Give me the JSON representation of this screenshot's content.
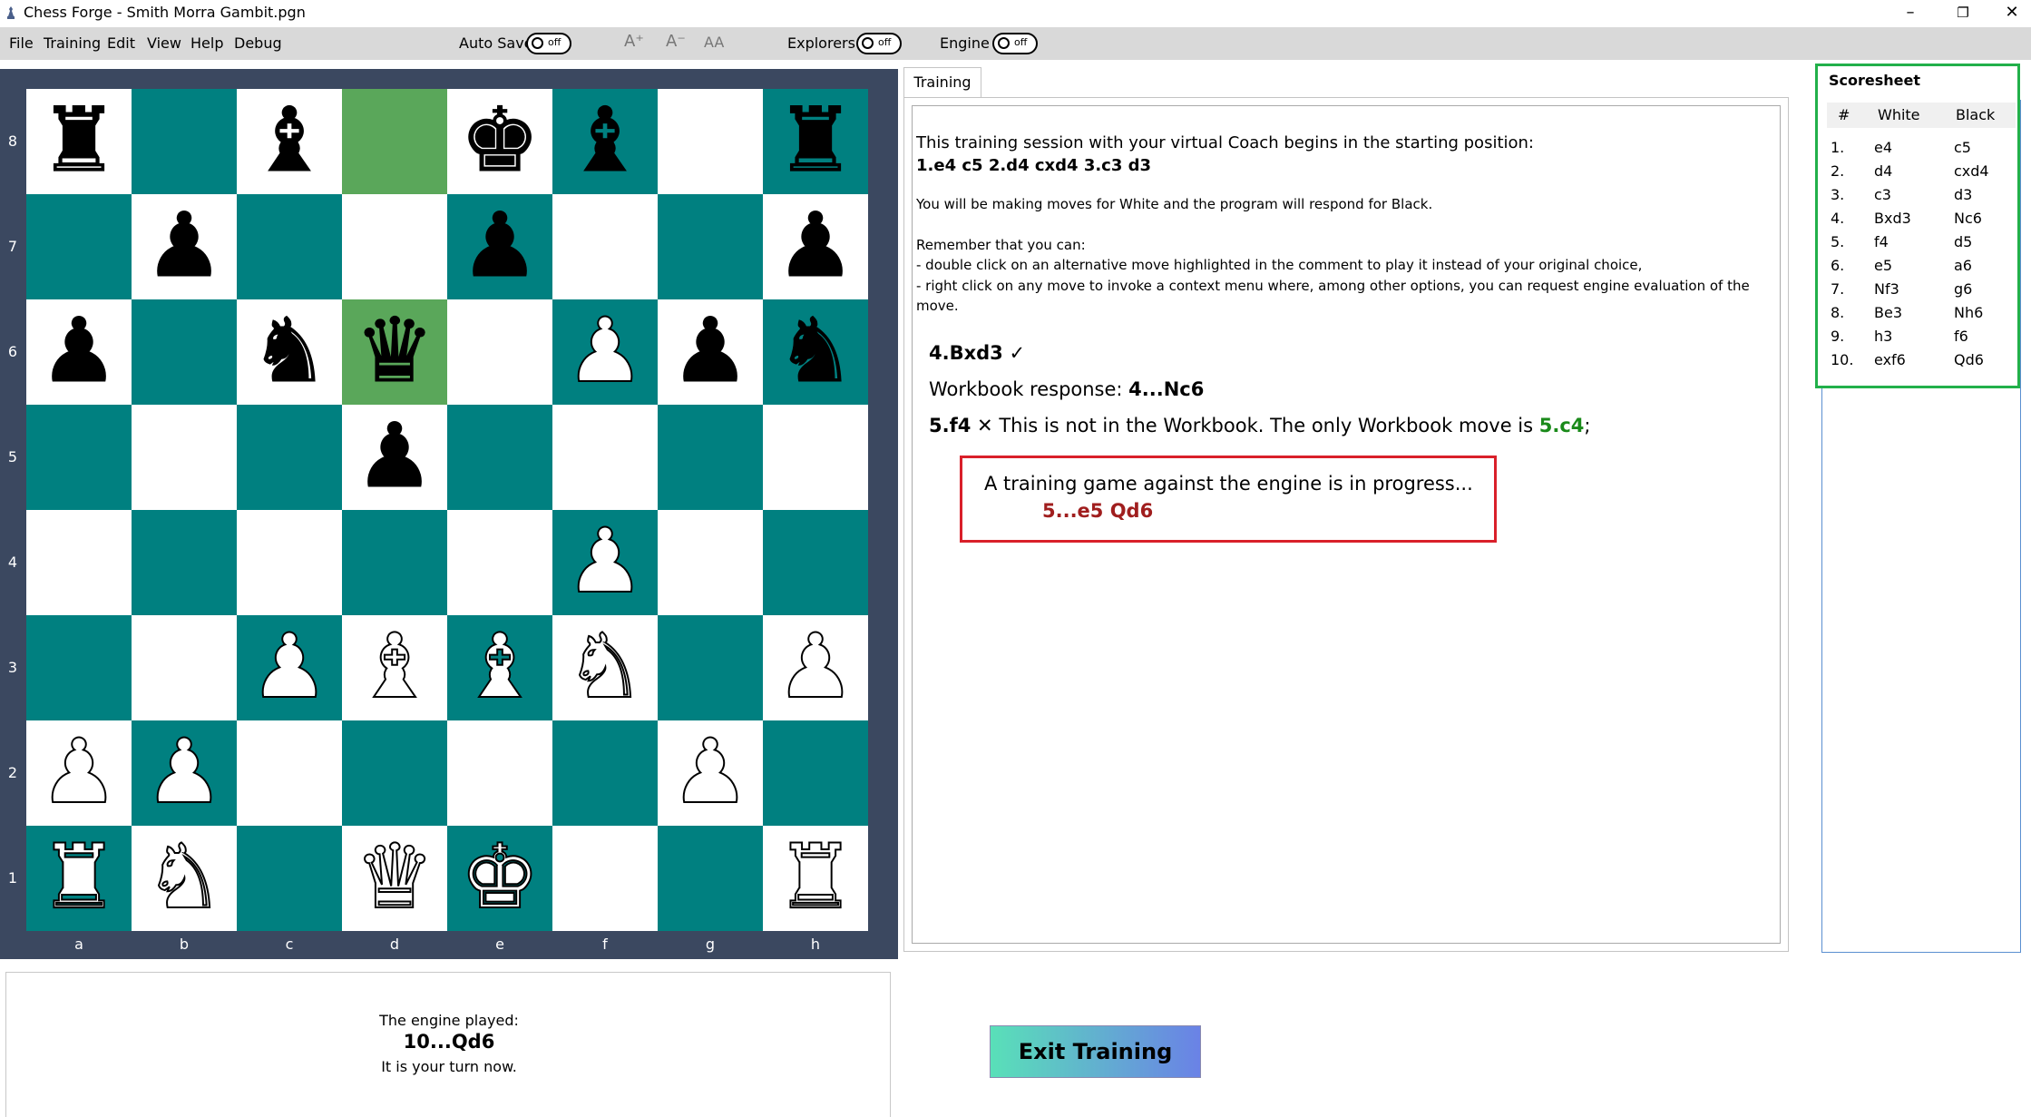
{
  "window": {
    "title": "Chess Forge - Smith Morra Gambit.pgn",
    "controls": {
      "minimize": "–",
      "restore": "❐",
      "close": "✕"
    }
  },
  "menu": {
    "items": [
      "File",
      "Training",
      "Edit",
      "View",
      "Help",
      "Debug"
    ]
  },
  "toolbar": {
    "auto_save_label": "Auto Save",
    "auto_save_state": "off",
    "font_buttons": [
      "A⁺",
      "A⁻",
      "AA"
    ],
    "explorers_label": "Explorers",
    "explorers_state": "off",
    "engine_label": "Engine",
    "engine_state": "off"
  },
  "board": {
    "ranks": [
      "8",
      "7",
      "6",
      "5",
      "4",
      "3",
      "2",
      "1"
    ],
    "files": [
      "a",
      "b",
      "c",
      "d",
      "e",
      "f",
      "g",
      "h"
    ],
    "highlighted_squares": [
      "d8",
      "d6"
    ],
    "pieces": [
      {
        "square": "a8",
        "piece": "rook",
        "color": "black",
        "glyph": "♜"
      },
      {
        "square": "c8",
        "piece": "bishop",
        "color": "black",
        "glyph": "♝"
      },
      {
        "square": "e8",
        "piece": "king",
        "color": "black",
        "glyph": "♚"
      },
      {
        "square": "f8",
        "piece": "bishop",
        "color": "black",
        "glyph": "♝"
      },
      {
        "square": "h8",
        "piece": "rook",
        "color": "black",
        "glyph": "♜"
      },
      {
        "square": "b7",
        "piece": "pawn",
        "color": "black",
        "glyph": "♟"
      },
      {
        "square": "e7",
        "piece": "pawn",
        "color": "black",
        "glyph": "♟"
      },
      {
        "square": "h7",
        "piece": "pawn",
        "color": "black",
        "glyph": "♟"
      },
      {
        "square": "a6",
        "piece": "pawn",
        "color": "black",
        "glyph": "♟"
      },
      {
        "square": "c6",
        "piece": "knight",
        "color": "black",
        "glyph": "♞"
      },
      {
        "square": "d6",
        "piece": "queen",
        "color": "black",
        "glyph": "♛"
      },
      {
        "square": "f6",
        "piece": "pawn",
        "color": "white",
        "glyph": "♟"
      },
      {
        "square": "g6",
        "piece": "pawn",
        "color": "black",
        "glyph": "♟"
      },
      {
        "square": "h6",
        "piece": "knight",
        "color": "black",
        "glyph": "♞"
      },
      {
        "square": "d5",
        "piece": "pawn",
        "color": "black",
        "glyph": "♟"
      },
      {
        "square": "f4",
        "piece": "pawn",
        "color": "white",
        "glyph": "♟"
      },
      {
        "square": "c3",
        "piece": "pawn",
        "color": "white",
        "glyph": "♟"
      },
      {
        "square": "d3",
        "piece": "bishop",
        "color": "white",
        "glyph": "♝"
      },
      {
        "square": "e3",
        "piece": "bishop",
        "color": "white",
        "glyph": "♝"
      },
      {
        "square": "f3",
        "piece": "knight",
        "color": "white",
        "glyph": "♞"
      },
      {
        "square": "h3",
        "piece": "pawn",
        "color": "white",
        "glyph": "♟"
      },
      {
        "square": "a2",
        "piece": "pawn",
        "color": "white",
        "glyph": "♟"
      },
      {
        "square": "b2",
        "piece": "pawn",
        "color": "white",
        "glyph": "♟"
      },
      {
        "square": "g2",
        "piece": "pawn",
        "color": "white",
        "glyph": "♟"
      },
      {
        "square": "a1",
        "piece": "rook",
        "color": "white",
        "glyph": "♜"
      },
      {
        "square": "b1",
        "piece": "knight",
        "color": "white",
        "glyph": "♞"
      },
      {
        "square": "d1",
        "piece": "queen",
        "color": "white",
        "glyph": "♛"
      },
      {
        "square": "e1",
        "piece": "king",
        "color": "white",
        "glyph": "♚"
      },
      {
        "square": "h1",
        "piece": "rook",
        "color": "white",
        "glyph": "♜"
      }
    ]
  },
  "engine_message": {
    "line1": "The engine played:",
    "move": "10...Qd6",
    "line3": "It is your turn now."
  },
  "training": {
    "tab_label": "Training",
    "intro": "This training session with your virtual Coach begins in the starting position:",
    "start_moves": "1.e4 c5 2.d4 cxd4 3.c3 d3",
    "role_note": "You will be making moves for White and the program will respond for Black.",
    "remember_title": "Remember that you can:",
    "tip1": "- double click on an alternative move highlighted in the comment to play it instead of your original choice,",
    "tip2a": "- right click on any move to invoke a context menu where, among other options, you can request engine evaluation of the",
    "tip2b": "move.",
    "move1": "4.Bxd3",
    "move1_mark": "✓",
    "response_label": "Workbook response: ",
    "response_move": "4...Nc6",
    "move2": "5.f4",
    "move2_mark": "✕",
    "move2_text": " This is not in the Workbook. The only Workbook move is ",
    "move2_alt": "5.c4",
    "move2_end": ";",
    "engine_game_text": "A training game against the engine is in progress...",
    "engine_game_moves": "5...e5 Qd6"
  },
  "exit_button_label": "Exit Training",
  "scoresheet": {
    "title": "Scoresheet",
    "headers": [
      "#",
      "White",
      "Black"
    ],
    "rows": [
      [
        "1.",
        "e4",
        "c5"
      ],
      [
        "2.",
        "d4",
        "cxd4"
      ],
      [
        "3.",
        "c3",
        "d3"
      ],
      [
        "4.",
        "Bxd3",
        "Nc6"
      ],
      [
        "5.",
        "f4",
        "d5"
      ],
      [
        "6.",
        "e5",
        "a6"
      ],
      [
        "7.",
        "Nf3",
        "g6"
      ],
      [
        "8.",
        "Be3",
        "Nh6"
      ],
      [
        "9.",
        "h3",
        "f6"
      ],
      [
        "10.",
        "exf6",
        "Qd6"
      ]
    ]
  },
  "colors": {
    "board_dark": "#008080",
    "board_light": "#ffffff",
    "highlight": "#5aa75a",
    "frame": "#3b4860",
    "engine_box_border": "#d9202a",
    "scoresheet_border": "#22b04a",
    "engine_moves": "#a01e1e"
  }
}
